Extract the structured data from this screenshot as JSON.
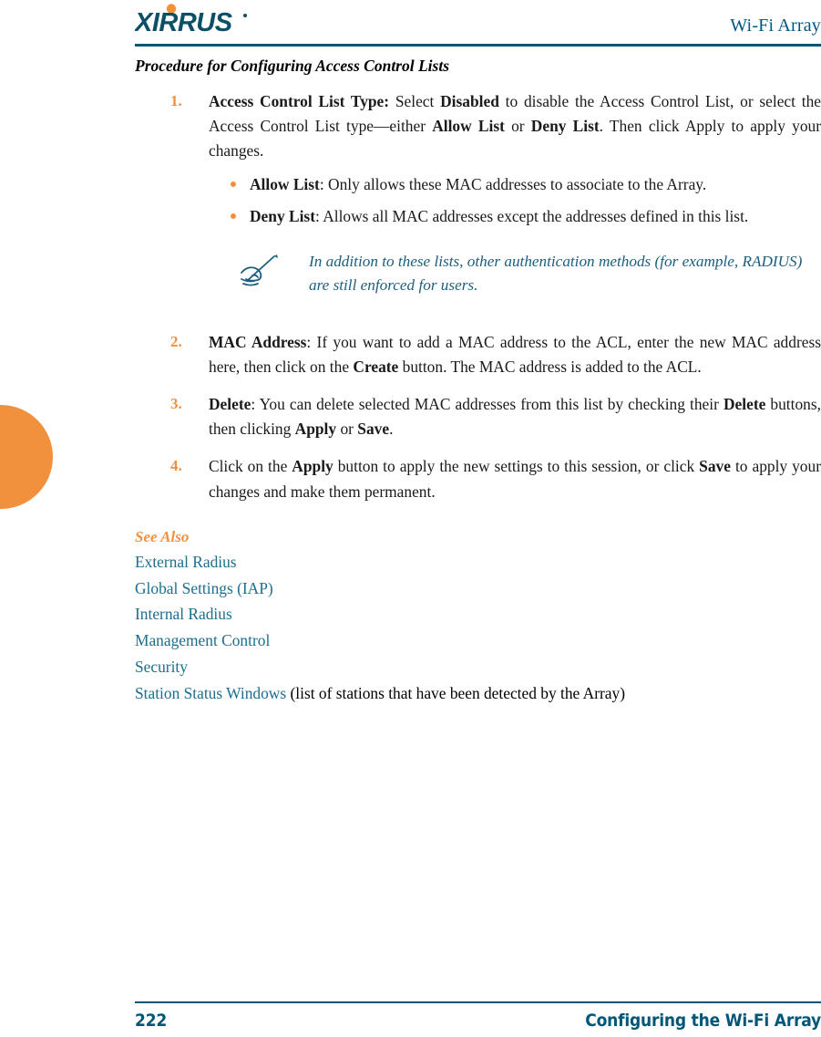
{
  "header": {
    "logo_text": "XIRRUS",
    "logo_icon": "xirrus-logo",
    "title": "Wi-Fi Array"
  },
  "content": {
    "procedure_heading": "Procedure for Configuring Access Control Lists",
    "steps": [
      {
        "number": "1.",
        "parts": [
          {
            "text": "Access Control List Type:",
            "style": "bold"
          },
          {
            "text": " Select ",
            "style": "normal"
          },
          {
            "text": "Disabled",
            "style": "bold"
          },
          {
            "text": " to disable the Access Control List, or select the Access Control List type—either ",
            "style": "normal"
          },
          {
            "text": "Allow List",
            "style": "bold"
          },
          {
            "text": " or ",
            "style": "normal"
          },
          {
            "text": "Deny List",
            "style": "bold"
          },
          {
            "text": ". Then click Apply to apply your changes.",
            "style": "normal"
          }
        ]
      },
      {
        "number": "2.",
        "parts": [
          {
            "text": "MAC Address",
            "style": "bold"
          },
          {
            "text": ": If you want to add a MAC address to the ACL, enter the new MAC address here, then click on the ",
            "style": "normal"
          },
          {
            "text": "Create",
            "style": "bold"
          },
          {
            "text": " button. The MAC address is added to the ACL.",
            "style": "normal"
          }
        ]
      },
      {
        "number": "3.",
        "parts": [
          {
            "text": "Delete",
            "style": "bold"
          },
          {
            "text": ": You can delete selected MAC addresses from this list by checking their ",
            "style": "normal"
          },
          {
            "text": "Delete",
            "style": "bold"
          },
          {
            "text": " buttons, then clicking ",
            "style": "normal"
          },
          {
            "text": "Apply",
            "style": "bold"
          },
          {
            "text": " or ",
            "style": "normal"
          },
          {
            "text": "Save",
            "style": "bold"
          },
          {
            "text": ".",
            "style": "normal"
          }
        ]
      },
      {
        "number": "4.",
        "parts": [
          {
            "text": "Click on the ",
            "style": "normal"
          },
          {
            "text": "Apply",
            "style": "bold"
          },
          {
            "text": " button to apply the new settings to this session, or click ",
            "style": "normal"
          },
          {
            "text": "Save",
            "style": "bold"
          },
          {
            "text": " to apply your changes and make them permanent.",
            "style": "normal"
          }
        ]
      }
    ],
    "bullets": [
      {
        "parts": [
          {
            "text": "Allow List",
            "style": "bold"
          },
          {
            "text": ": Only allows these MAC addresses to associate to the Array.",
            "style": "normal"
          }
        ]
      },
      {
        "parts": [
          {
            "text": "Deny List",
            "style": "bold"
          },
          {
            "text": ": Allows all MAC addresses except the addresses defined in this list.",
            "style": "normal"
          }
        ]
      }
    ],
    "note": {
      "icon": "note-writing-hand-icon",
      "text": "In addition to these lists, other authentication methods (for example, RADIUS) are still enforced for users."
    },
    "see_also": {
      "title": "See Also",
      "links": [
        {
          "label": "External Radius",
          "suffix": ""
        },
        {
          "label": "Global Settings (IAP)",
          "suffix": ""
        },
        {
          "label": "Internal Radius",
          "suffix": ""
        },
        {
          "label": "Management Control",
          "suffix": ""
        },
        {
          "label": "Security",
          "suffix": ""
        },
        {
          "label": "Station Status Windows",
          "suffix": " (list of stations that have been detected by the Array)"
        }
      ]
    }
  },
  "footer": {
    "page_number": "222",
    "section_title": "Configuring the Wi-Fi Array"
  },
  "colors": {
    "accent_orange": "#f2913d",
    "brand_teal": "#015677",
    "link_teal": "#1b6e8e",
    "note_teal": "#1b5e7e",
    "text_black": "#000000"
  }
}
